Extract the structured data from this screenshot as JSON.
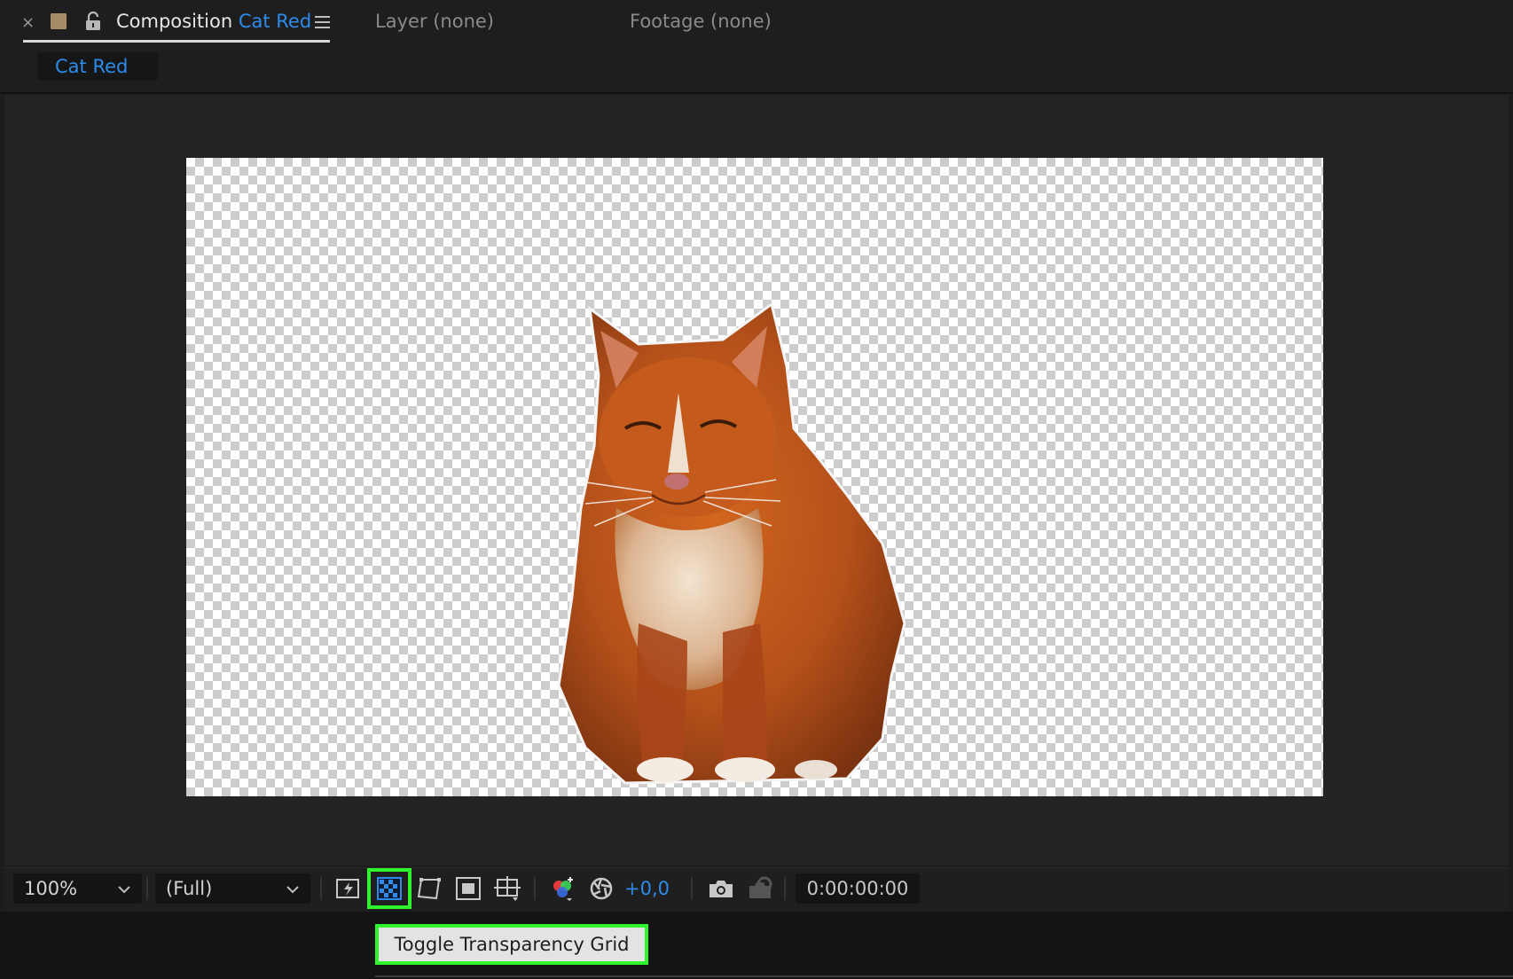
{
  "panel_tabs": {
    "composition": {
      "close_glyph": "×",
      "prefix": "Composition",
      "name": "Cat Red",
      "label_color": "#2d8ceb",
      "swatch_color": "#a48c68"
    },
    "layer": {
      "label": "Layer (none)"
    },
    "footage": {
      "label": "Footage (none)"
    }
  },
  "breadcrumb": {
    "label": "Cat Red"
  },
  "viewer": {
    "transparency_grid": true,
    "layer_subject": "orange-cat"
  },
  "toolbar": {
    "magnification": "100%",
    "resolution": "(Full)",
    "exposure": "+0,0",
    "timecode": "0:00:00:00",
    "highlight_color": "#2ef52e",
    "icons": [
      "fast-previews-icon",
      "transparency-grid-icon",
      "mask-visibility-icon",
      "region-of-interest-icon",
      "grid-guides-icon",
      "channel-icon",
      "reset-exposure-icon",
      "snapshot-icon",
      "show-snapshot-icon"
    ]
  },
  "tooltip": {
    "text": "Toggle Transparency Grid"
  }
}
